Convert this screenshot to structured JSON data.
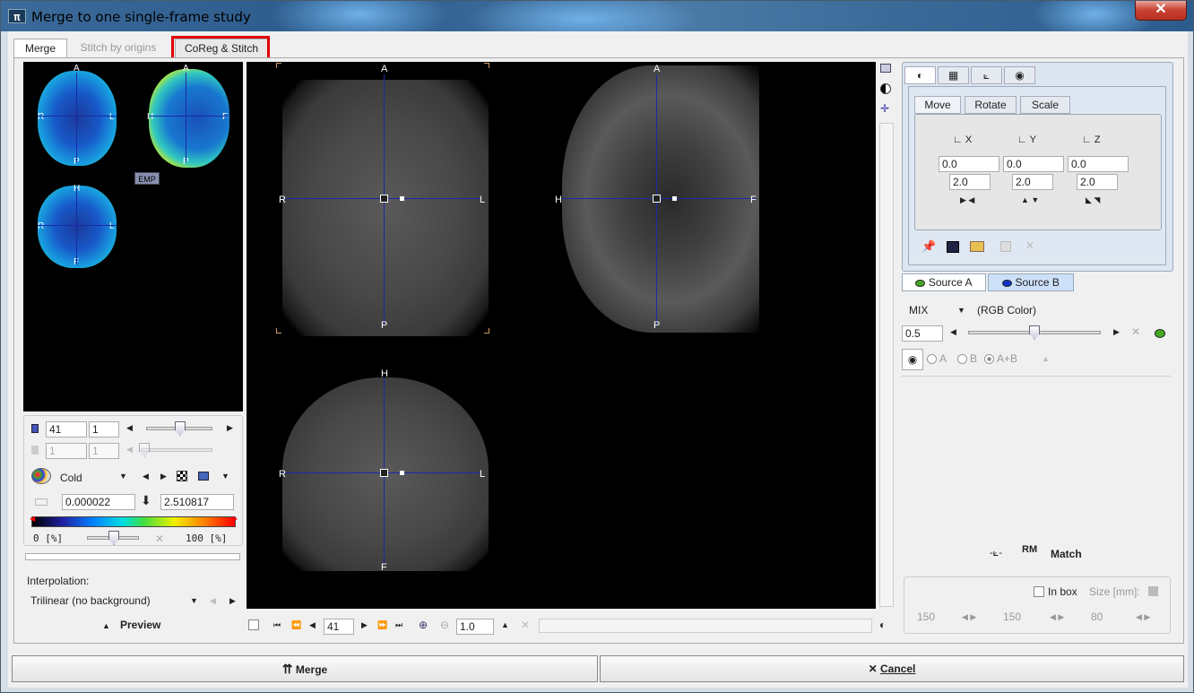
{
  "window": {
    "title": "Merge to one single-frame study",
    "close_label": "✕"
  },
  "tabs": [
    {
      "label": "Merge"
    },
    {
      "label": "Stitch by origins"
    },
    {
      "label": "CoReg & Stitch"
    }
  ],
  "left": {
    "emp_label": "EMP",
    "mini_labels": {
      "top": "A",
      "bottom": "P",
      "left": "R",
      "right": "L",
      "h": "H",
      "f": "F"
    },
    "frame": "41",
    "frame_step": "1",
    "frame2": "1",
    "frame2_step": "1",
    "colormap": "Cold",
    "min_value": "0.000022",
    "max_value": "2.510817",
    "range_min": "0 [%]",
    "range_max": "100 [%]",
    "interpolation_label": "Interpolation:",
    "interpolation_value": "Trilinear (no background)",
    "preview_label": "Preview"
  },
  "viewer": {
    "labels": {
      "a": "A",
      "p": "P",
      "r": "R",
      "l": "L",
      "h": "H",
      "f": "F"
    },
    "slice": "41",
    "zoom": "1.0"
  },
  "right": {
    "subtabs": [
      {
        "label": "Move"
      },
      {
        "label": "Rotate"
      },
      {
        "label": "Scale"
      }
    ],
    "axes": [
      {
        "label": "X",
        "value": "0.0",
        "step": "2.0"
      },
      {
        "label": "Y",
        "value": "0.0",
        "step": "2.0"
      },
      {
        "label": "Z",
        "value": "0.0",
        "step": "2.0"
      }
    ],
    "source_a": "Source A",
    "source_b": "Source B",
    "mix_label": "MIX",
    "mix_mode": "(RGB Color)",
    "mix_value": "0.5",
    "mix_fraction": 0.5,
    "radio_a": "A",
    "radio_b": "B",
    "radio_ab": "A+B",
    "match_label": "Match",
    "inbox_label": "In box",
    "size_label": "Size [mm]:",
    "sizes": [
      "150",
      "150",
      "80"
    ]
  },
  "footer": {
    "merge_label": "Merge",
    "cancel_label": "Cancel"
  },
  "colors": {
    "accent_blue": "#1a2aa8",
    "highlight_red": "#e00000",
    "source_a": "#44aa22",
    "source_b": "#1133cc"
  }
}
